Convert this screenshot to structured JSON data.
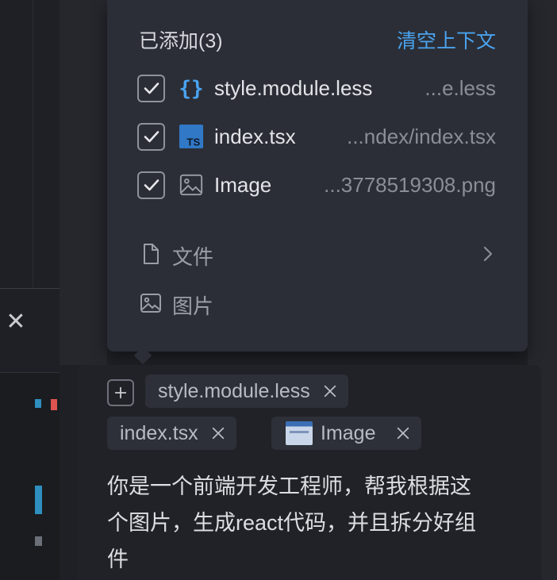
{
  "popup": {
    "title": "已添加(3)",
    "clear_label": "清空上下文",
    "items": [
      {
        "icon": "braces-icon",
        "name": "style.module.less",
        "path": "...e.less",
        "checked": true
      },
      {
        "icon": "typescript-icon",
        "name": "index.tsx",
        "path": "...ndex/index.tsx",
        "checked": true
      },
      {
        "icon": "image-icon",
        "name": "Image",
        "path": "...3778519308.png",
        "checked": true
      }
    ],
    "menu": [
      {
        "icon": "file-icon",
        "label": "文件",
        "has_submenu": true
      },
      {
        "icon": "image-icon",
        "label": "图片",
        "has_submenu": false
      }
    ],
    "ts_badge": "TS"
  },
  "input": {
    "chips": [
      {
        "label": "style.module.less"
      },
      {
        "label": "index.tsx"
      },
      {
        "label": "Image",
        "has_thumbnail": true
      }
    ],
    "prompt": "你是一个前端开发工程师，帮我根据这个图片，生成react代码，并且拆分好组件"
  },
  "colors": {
    "background": "#1e2025",
    "popup_bg": "#2b2e36",
    "accent": "#4aa3f0",
    "chip_bg": "#2d3038",
    "braces_icon": "#4aa3f0",
    "ts_icon": "#3178c6"
  }
}
